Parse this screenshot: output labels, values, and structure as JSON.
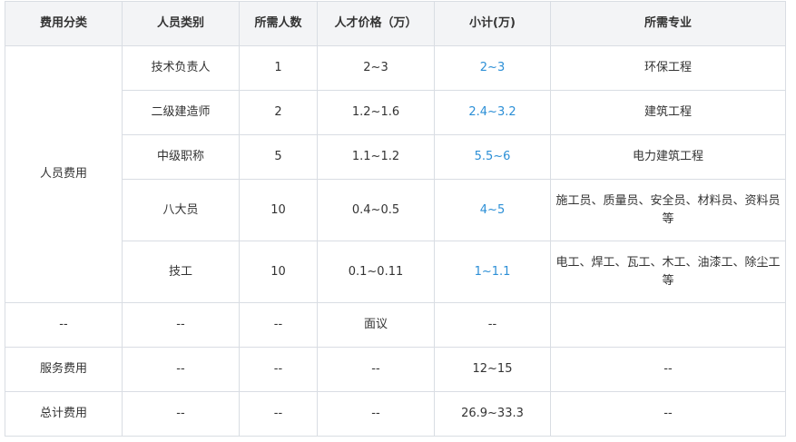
{
  "headers": [
    "费用分类",
    "人员类别",
    "所需人数",
    "人才价格（万）",
    "小计(万)",
    "所需专业"
  ],
  "personnel_category": "人员费用",
  "rows": [
    {
      "type": "技术负责人",
      "count": "1",
      "price": "2~3",
      "subtotal": "2~3",
      "major": "环保工程"
    },
    {
      "type": "二级建造师",
      "count": "2",
      "price": "1.2~1.6",
      "subtotal": "2.4~3.2",
      "major": "建筑工程"
    },
    {
      "type": "中级职称",
      "count": "5",
      "price": "1.1~1.2",
      "subtotal": "5.5~6",
      "major": "电力建筑工程"
    },
    {
      "type": "八大员",
      "count": "10",
      "price": "0.4~0.5",
      "subtotal": "4~5",
      "major": "施工员、质量员、安全员、材料员、资料员等"
    },
    {
      "type": "技工",
      "count": "10",
      "price": "0.1~0.11",
      "subtotal": "1~1.1",
      "major": "电工、焊工、瓦工、木工、油漆工、除尘工等"
    }
  ],
  "misc_row": {
    "category": "--",
    "type": "--",
    "count": "--",
    "price": "面议",
    "subtotal": "--",
    "major": ""
  },
  "service_row": {
    "category": "服务费用",
    "type": "--",
    "count": "--",
    "price": "--",
    "subtotal": "12~15",
    "major": "--"
  },
  "total_row": {
    "category": "总计费用",
    "type": "--",
    "count": "--",
    "price": "--",
    "subtotal": "26.9~33.3",
    "major": "--"
  },
  "colors": {
    "subtotal_text": "#2c8fd6",
    "header_bg": "#f3f4f6",
    "border": "#d9dde3"
  }
}
